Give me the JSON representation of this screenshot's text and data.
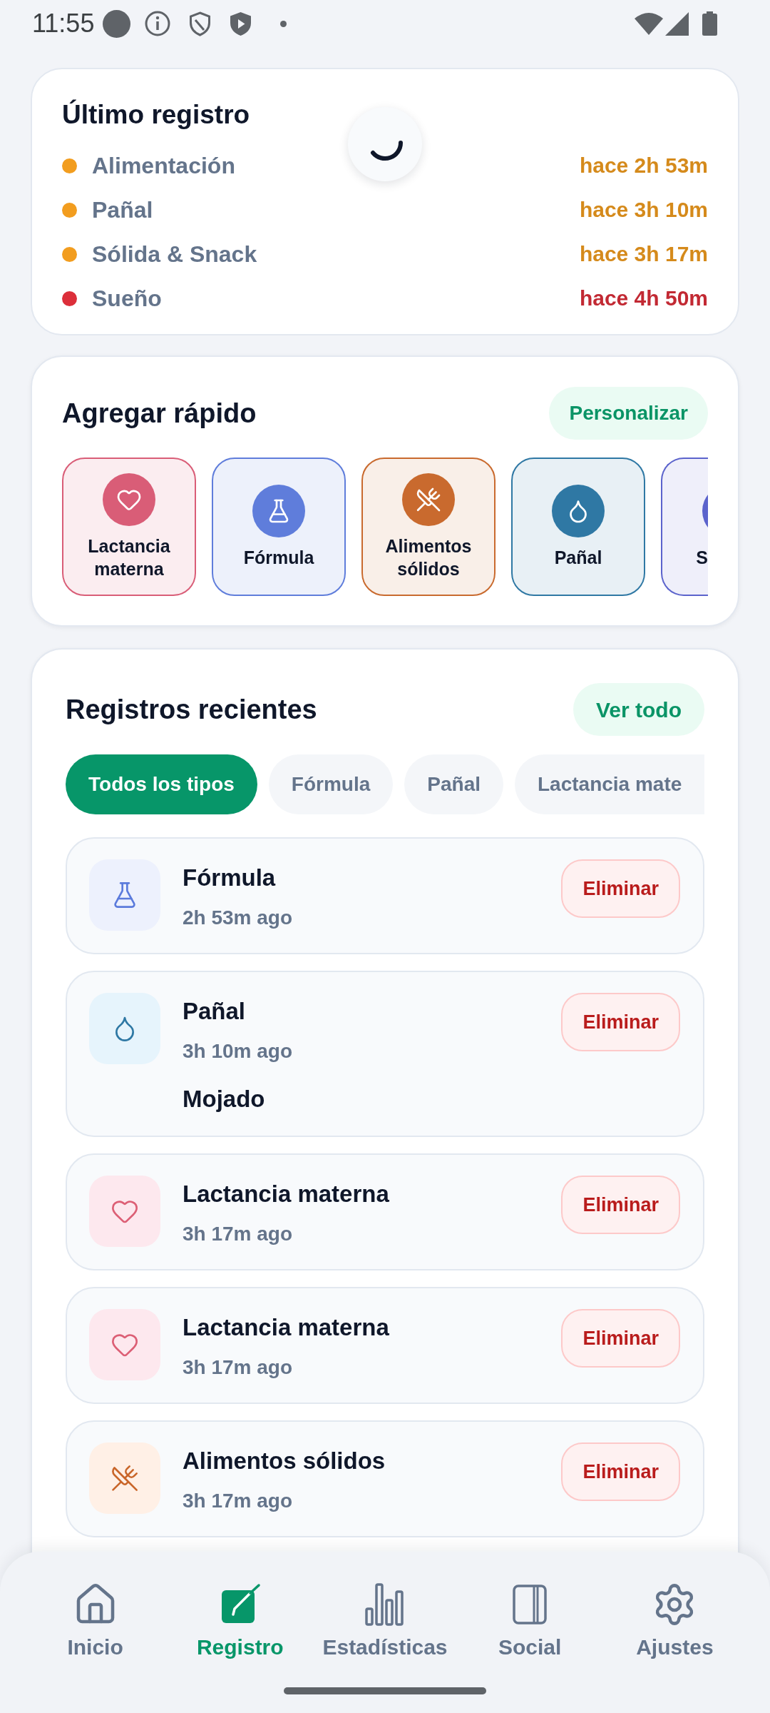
{
  "status_bar": {
    "time": "11:55"
  },
  "last_log": {
    "title": "Último registro",
    "loading": true,
    "rows": [
      {
        "label": "Alimentación",
        "value": "hace 2h 53m",
        "color": "#f29d1f"
      },
      {
        "label": "Pañal",
        "value": "hace 3h 10m",
        "color": "#f29d1f"
      },
      {
        "label": "Sólida & Snack",
        "value": "hace 3h 17m",
        "color": "#f29d1f"
      },
      {
        "label": "Sueño",
        "value": "hace 4h 50m",
        "color": "#dc2f3a"
      }
    ]
  },
  "quick_add": {
    "title": "Agregar rápido",
    "customize_button": "Personalizar",
    "items": [
      {
        "kind": "breastfeeding",
        "label": "Lactancia materna",
        "color": "#d95d77"
      },
      {
        "kind": "formula",
        "label": "Fórmula",
        "color": "#5f7ddb"
      },
      {
        "kind": "solids",
        "label": "Alimentos sólidos",
        "color": "#c96a2e"
      },
      {
        "kind": "diaper",
        "label": "Pañal",
        "color": "#2f78a4"
      },
      {
        "label": "S",
        "color": "#5b63cc"
      }
    ]
  },
  "recent": {
    "title": "Registros recientes",
    "view_all_button": "Ver todo",
    "filters": [
      {
        "label": "Todos los tipos",
        "selected": true
      },
      {
        "label": "Fórmula",
        "selected": false
      },
      {
        "label": "Pañal",
        "selected": false
      },
      {
        "label": "Lactancia mate",
        "selected": false
      }
    ],
    "records": [
      {
        "kind": "formula",
        "title": "Fórmula",
        "time": "2h 53m ago",
        "delete_button": "Eliminar"
      },
      {
        "kind": "diaper",
        "title": "Pañal",
        "time": "3h 10m ago",
        "note": "Mojado",
        "delete_button": "Eliminar"
      },
      {
        "kind": "breastfeeding",
        "title": "Lactancia materna",
        "time": "3h 17m ago",
        "delete_button": "Eliminar"
      },
      {
        "kind": "breastfeeding",
        "title": "Lactancia materna",
        "time": "3h 17m ago",
        "delete_button": "Eliminar"
      },
      {
        "kind": "solids",
        "title": "Alimentos sólidos",
        "time": "3h 17m ago",
        "delete_button": "Eliminar"
      }
    ]
  },
  "nav": [
    {
      "label": "Inicio",
      "selected": false
    },
    {
      "label": "Registro",
      "selected": true
    },
    {
      "label": "Estadísticas",
      "selected": false
    },
    {
      "label": "Social",
      "selected": false
    },
    {
      "label": "Ajustes",
      "selected": false
    }
  ]
}
